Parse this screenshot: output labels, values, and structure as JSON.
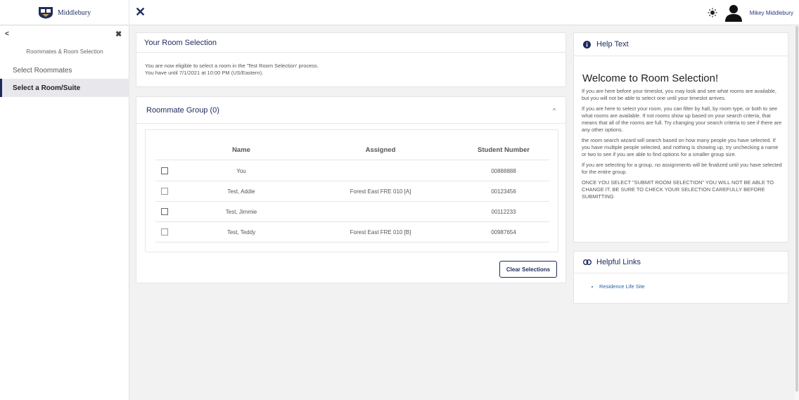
{
  "app": {
    "logo_text": "Middlebury",
    "user_name": "Mikey Middlebury"
  },
  "sidebar": {
    "title": "Roommates & Room Selection",
    "items": [
      {
        "label": "Select Roommates"
      },
      {
        "label": "Select a Room/Suite"
      }
    ]
  },
  "room_selection": {
    "title": "Your Room Selection",
    "line1": "You are now eligible to select a room in the 'Test Room Selection' process.",
    "line2": "You have until 7/1/2021 at 10:00 PM (US/Eastern)."
  },
  "roommate_group": {
    "title": "Roommate Group (0)",
    "columns": {
      "name": "Name",
      "assigned": "Assigned",
      "student_number": "Student Number"
    },
    "rows": [
      {
        "name": "You",
        "assigned": "",
        "student_number": "00888888"
      },
      {
        "name": "Test, Addie",
        "assigned": "Forest East FRE 010 [A]",
        "student_number": "00123456"
      },
      {
        "name": "Test, Jimmie",
        "assigned": "",
        "student_number": "00112233"
      },
      {
        "name": "Test, Teddy",
        "assigned": "Forest East FRE 010 [B]",
        "student_number": "00987654"
      }
    ],
    "clear_label": "Clear Selections"
  },
  "help": {
    "title": "Help Text",
    "welcome": "Welcome to Room Selection!",
    "paragraphs": [
      "If you are here before your timeslot, you may look and see what rooms are available, but you will not be able to select one until your timeslot arrives.",
      "If you are here to select your room, you can filter by hall, by room type, or both to see what rooms are available. If not rooms show up based on your search criteria, that means that all of the rooms are full. Try changing your search criteria to see if there are any other options.",
      "the room search wizard will search based on how many people you have selected. If you have multiple people selected, and nothing is showing up, try unchecking a name or two to see if you are able to find options for a smaller group size.",
      "If you are selecting for a group, no assignments will be finalized until you have selected for the entire group.",
      "ONCE YOU SELECT \"SUBMIT ROOM SELECTION\" YOU WILL NOT BE ABLE TO CHANGE IT. BE SURE TO CHECK YOUR SELECTION CAREFULLY BEFORE SUBMITTING"
    ]
  },
  "links": {
    "title": "Helpful Links",
    "items": [
      {
        "label": "Residence Life Site"
      }
    ]
  },
  "icons": {
    "close": "close-icon",
    "theme": "sun-icon",
    "avatar": "user-avatar-icon",
    "info": "info-icon",
    "link": "link-icon",
    "collapse": "chevron-up-icon"
  },
  "colors": {
    "brand": "#1c2a5c",
    "link": "#2563a6",
    "background": "#f2f2f2"
  }
}
